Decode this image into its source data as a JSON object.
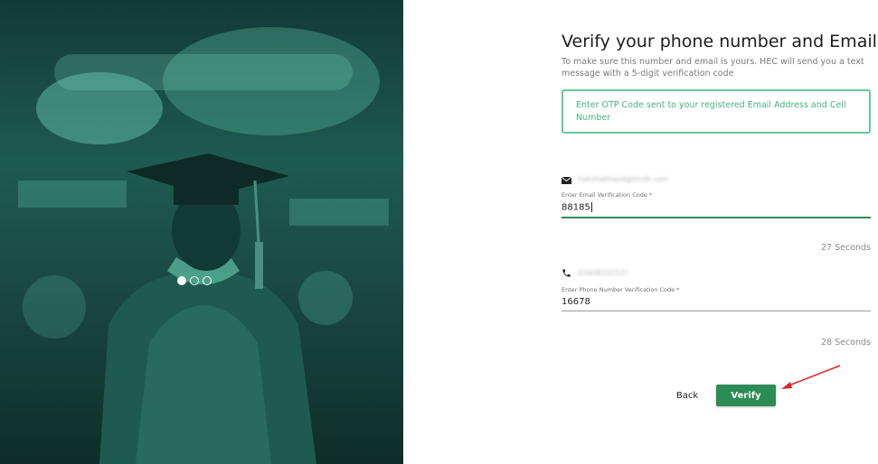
{
  "hero": {
    "carousel": {
      "slides": 3,
      "active_index": 0
    }
  },
  "form": {
    "title": "Verify your phone number and Email",
    "subtitle": "To make sure this number and email is yours. HEC will send you a text message with a 5-digit verification code",
    "otp_notice": "Enter OTP Code sent to your registered Email Address and Cell Number",
    "email": {
      "icon": "envelope-icon",
      "label": "Enter Email Verification Code *",
      "value": "88185",
      "timer": "27 Seconds"
    },
    "phone": {
      "icon": "phone-icon",
      "label": "Enter Phone Number Verification Code *",
      "value": "16678",
      "timer": "28 Seconds"
    }
  },
  "actions": {
    "back_label": "Back",
    "verify_label": "Verify"
  },
  "colors": {
    "accent": "#2d8b55",
    "notice_border": "#66c79a",
    "notice_text": "#44b37b",
    "hero_tint": "#1d5b52",
    "annotation_arrow": "#d9262b"
  }
}
